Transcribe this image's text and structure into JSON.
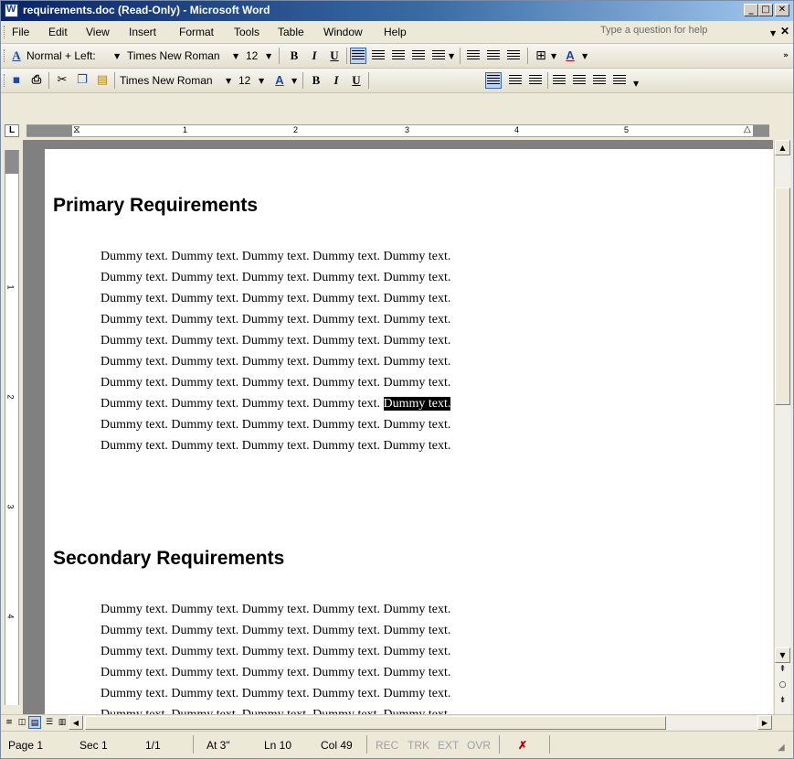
{
  "window": {
    "title": "requirements.doc (Read-Only) - Microsoft Word",
    "min_glyph": "_",
    "max_glyph": "□",
    "close_glyph": "✕"
  },
  "menu": {
    "items": [
      "File",
      "Edit",
      "View",
      "Insert",
      "Format",
      "Tools",
      "Table",
      "Window",
      "Help"
    ],
    "help_placeholder": "Type a question for help",
    "close_doc": "✕"
  },
  "formatting_toolbar": {
    "style": "Normal + Left:",
    "font": "Times New Roman",
    "size": "12",
    "bold": "B",
    "italic": "I",
    "underline": "U",
    "font_color_glyph": "A"
  },
  "standard_toolbar": {
    "font": "Times New Roman",
    "size": "12",
    "bold": "B",
    "italic": "I",
    "underline": "U",
    "font_color_glyph": "A"
  },
  "ruler": {
    "corner": "L",
    "marks": [
      "1",
      "2",
      "3",
      "4",
      "5"
    ],
    "vmarks": [
      "1",
      "2",
      "3",
      "4"
    ]
  },
  "document": {
    "sections": [
      {
        "heading": "Primary Requirements",
        "lines": [
          "Dummy text. Dummy text. Dummy text. Dummy text. Dummy text.",
          "Dummy text. Dummy text. Dummy text. Dummy text. Dummy text.",
          "Dummy text. Dummy text. Dummy text. Dummy text. Dummy text.",
          "Dummy text. Dummy text. Dummy text. Dummy text. Dummy text.",
          "Dummy text. Dummy text. Dummy text. Dummy text. Dummy text.",
          "Dummy text. Dummy text. Dummy text. Dummy text. Dummy text.",
          "Dummy text. Dummy text. Dummy text. Dummy text. Dummy text.",
          "Dummy text. Dummy text. Dummy text. Dummy text. ",
          "Dummy text. Dummy text. Dummy text. Dummy text. Dummy text.",
          "Dummy text. Dummy text. Dummy text. Dummy text. Dummy text."
        ],
        "selected_text": "Dummy text."
      },
      {
        "heading": "Secondary Requirements",
        "lines": [
          "Dummy text. Dummy text. Dummy text. Dummy text. Dummy text.",
          "Dummy text. Dummy text. Dummy text. Dummy text. Dummy text.",
          "Dummy text. Dummy text. Dummy text. Dummy text. Dummy text.",
          "Dummy text. Dummy text. Dummy text. Dummy text. Dummy text.",
          "Dummy text. Dummy text. Dummy text. Dummy text. Dummy text.",
          "Dummy text. Dummy text. Dummy text. Dummy text. Dummy text."
        ]
      }
    ]
  },
  "status": {
    "page": "Page 1",
    "sec": "Sec 1",
    "pages": "1/1",
    "at": "At 3\"",
    "ln": "Ln 10",
    "col": "Col 49",
    "rec": "REC",
    "trk": "TRK",
    "ext": "EXT",
    "ovr": "OVR"
  },
  "colors": {
    "title_gradient_start": "#0a246a",
    "selection": "#000000",
    "page_bg": "#ffffff",
    "workspace": "#808080"
  }
}
